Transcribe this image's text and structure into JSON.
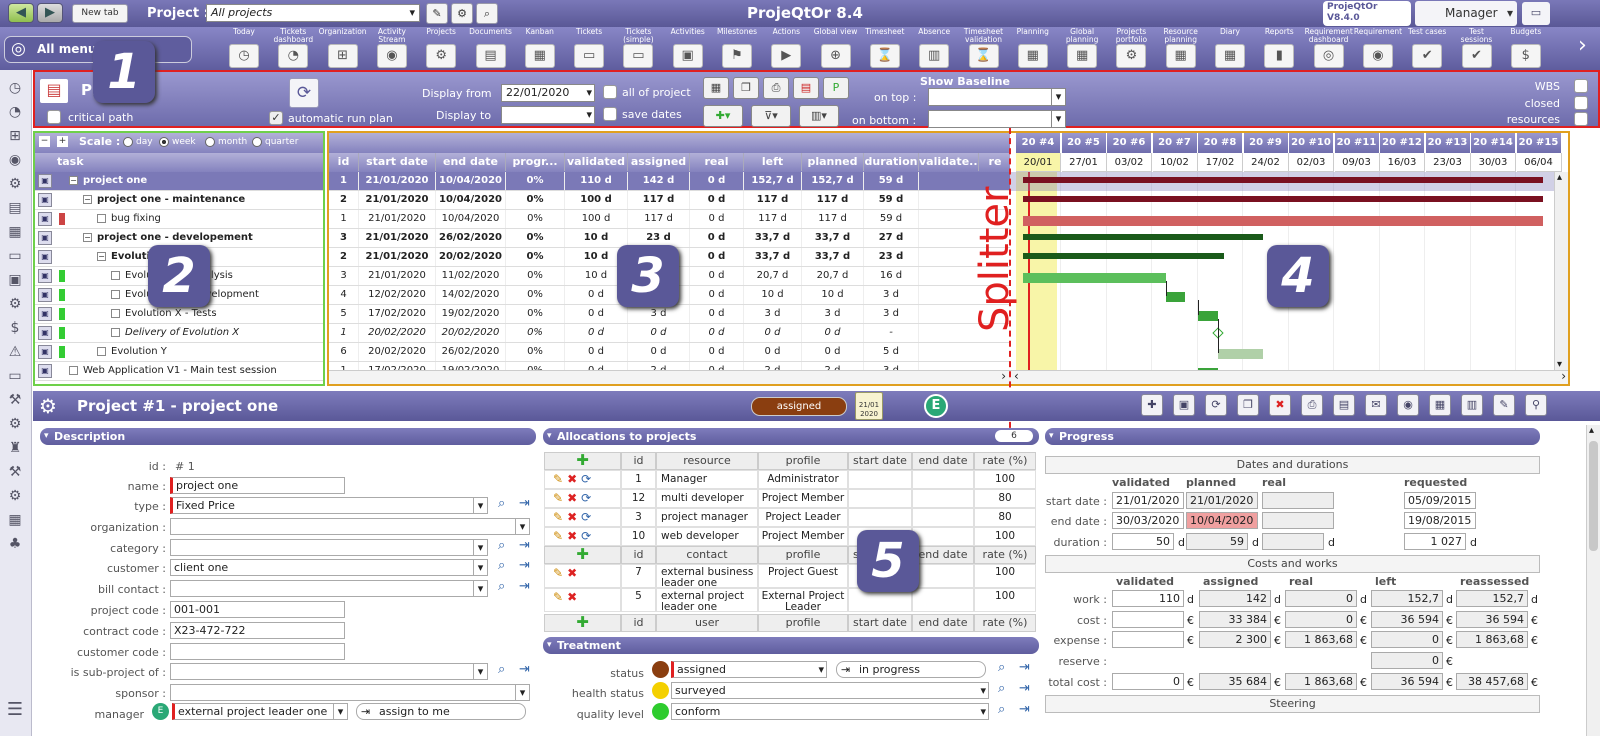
{
  "app": {
    "title": "ProjeQtOr 8.4",
    "logo_line1": "ProjeQtOr",
    "logo_line2": "V8.4.0",
    "user": "Manager",
    "project_label": "Project :",
    "project_value": "All projects",
    "new_tab": "New tab",
    "all_menus": "All menus"
  },
  "menu": [
    "Today",
    "Tickets dashboard",
    "Organizations",
    "Activity Stream",
    "Projects",
    "Documents",
    "Kanban",
    "Tickets",
    "Tickets (simple)",
    "Activities",
    "Milestones",
    "Actions",
    "Global view",
    "Timesheet",
    "Absence",
    "Timesheet validation",
    "Planning",
    "Global planning",
    "Projects portfolio",
    "Resource planning",
    "Diary",
    "Reports",
    "Requirements dashboard",
    "Requirements",
    "Test cases",
    "Test sessions",
    "Budgets"
  ],
  "toolbar": {
    "title": "Pl",
    "critical_path": "critical path",
    "automatic_run_plan": "automatic run plan",
    "display_from": "Display from",
    "display_from_value": "22/01/2020",
    "display_to": "Display to",
    "all_of_project": "all of project",
    "save_dates": "save dates",
    "show_baseline": "Show Baseline",
    "on_top": "on top :",
    "on_bottom": "on bottom :",
    "wbs": "WBS",
    "closed": "closed",
    "resources": "resources"
  },
  "grid": {
    "scale_label": "Scale :",
    "scale_options": [
      "day",
      "week",
      "month",
      "quarter"
    ],
    "task_header": "task",
    "columns": [
      "id",
      "start date",
      "end date",
      "progr...",
      "validated",
      "assigned",
      "real",
      "left",
      "planned",
      "duration",
      "validate...",
      "re"
    ],
    "rows": [
      {
        "name": "project one",
        "cells": [
          "1",
          "21/01/2020",
          "10/04/2020",
          "0%",
          "110 d",
          "142 d",
          "0 d",
          "152,7 d",
          "152,7 d",
          "59 d"
        ],
        "style": "sel"
      },
      {
        "name": "project one - maintenance",
        "cells": [
          "2",
          "21/01/2020",
          "10/04/2020",
          "0%",
          "100 d",
          "117 d",
          "0 d",
          "117 d",
          "117 d",
          "59 d"
        ],
        "style": "bold"
      },
      {
        "name": "bug fixing",
        "cells": [
          "1",
          "21/01/2020",
          "10/04/2020",
          "0%",
          "100 d",
          "117 d",
          "0 d",
          "117 d",
          "117 d",
          "59 d"
        ],
        "style": ""
      },
      {
        "name": "project one - developement",
        "cells": [
          "3",
          "21/01/2020",
          "26/02/2020",
          "0%",
          "10 d",
          "23 d",
          "0 d",
          "33,7 d",
          "33,7 d",
          "27 d"
        ],
        "style": "bold"
      },
      {
        "name": "Evolution X",
        "cells": [
          "2",
          "21/01/2020",
          "20/02/2020",
          "0%",
          "10 d",
          "23 d",
          "0 d",
          "33,7 d",
          "33,7 d",
          "23 d"
        ],
        "style": "bold"
      },
      {
        "name": "Evolution X - Analysis",
        "cells": [
          "3",
          "21/01/2020",
          "11/02/2020",
          "0%",
          "10 d",
          "7 d",
          "0 d",
          "20,7 d",
          "20,7 d",
          "16 d"
        ],
        "style": ""
      },
      {
        "name": "Evolution X - Development",
        "cells": [
          "4",
          "12/02/2020",
          "14/02/2020",
          "0%",
          "0 d",
          "10 d",
          "0 d",
          "10 d",
          "10 d",
          "3 d"
        ],
        "style": ""
      },
      {
        "name": "Evolution X - Tests",
        "cells": [
          "5",
          "17/02/2020",
          "19/02/2020",
          "0%",
          "0 d",
          "3 d",
          "0 d",
          "3 d",
          "3 d",
          "3 d"
        ],
        "style": ""
      },
      {
        "name": "Delivery of Evolution X",
        "cells": [
          "1",
          "20/02/2020",
          "20/02/2020",
          "0%",
          "0 d",
          "0 d",
          "0 d",
          "0 d",
          "0 d",
          "-"
        ],
        "style": "ital"
      },
      {
        "name": "Evolution Y",
        "cells": [
          "6",
          "20/02/2020",
          "26/02/2020",
          "0%",
          "0 d",
          "0 d",
          "0 d",
          "0 d",
          "0 d",
          "5 d"
        ],
        "style": ""
      },
      {
        "name": "Web Application V1 - Main test session",
        "cells": [
          "1",
          "17/02/2020",
          "19/02/2020",
          "0%",
          "0 d",
          "2 d",
          "0 d",
          "2 d",
          "2 d",
          "3 d"
        ],
        "style": ""
      }
    ]
  },
  "gantt": {
    "weeks": [
      "20 #4",
      "20 #5",
      "20 #6",
      "20 #7",
      "20 #8",
      "20 #9",
      "20 #10",
      "20 #11",
      "20 #12",
      "20 #13",
      "20 #14",
      "20 #15"
    ],
    "dates": [
      "20/01",
      "27/01",
      "03/02",
      "10/02",
      "17/02",
      "24/02",
      "02/03",
      "09/03",
      "16/03",
      "23/03",
      "30/03",
      "06/04"
    ]
  },
  "annotations": {
    "n1": "1",
    "n2": "2",
    "n3": "3",
    "n4": "4",
    "n5": "5",
    "splitter": "Splitter"
  },
  "detail": {
    "title": "Project  #1 - project one",
    "status_badge": "assigned",
    "date_badge_line1": "21/01",
    "date_badge_line2": "2020",
    "avatar": "E",
    "description": {
      "header": "Description",
      "id_label": "id :",
      "id_value": "#  1",
      "name_label": "name :",
      "name_value": "project one",
      "type_label": "type :",
      "type_value": "Fixed Price",
      "organization_label": "organization :",
      "category_label": "category :",
      "customer_label": "customer :",
      "customer_value": "client one",
      "bill_contact_label": "bill contact :",
      "project_code_label": "project code :",
      "project_code_value": "001-001",
      "contract_code_label": "contract code :",
      "contract_code_value": "X23-472-722",
      "customer_code_label": "customer code :",
      "subproject_label": "is sub-project of :",
      "sponsor_label": "sponsor :",
      "manager_label": "manager",
      "manager_value": "external project leader one",
      "assign_to_me": "assign to me"
    },
    "allocations": {
      "header": "Allocations to projects",
      "count": "6",
      "res_cols": [
        "id",
        "resource",
        "profile",
        "start date",
        "end date",
        "rate (%)"
      ],
      "res_rows": [
        [
          "1",
          "Manager",
          "Administrator",
          "",
          "",
          "100"
        ],
        [
          "12",
          "multi developer",
          "Project Member",
          "",
          "",
          "80"
        ],
        [
          "3",
          "project manager",
          "Project Leader",
          "",
          "",
          "80"
        ],
        [
          "10",
          "web developer",
          "Project Member",
          "",
          "",
          "100"
        ]
      ],
      "contact_cols": [
        "id",
        "contact",
        "profile",
        "start date",
        "end date",
        "rate (%)"
      ],
      "contact_rows": [
        [
          "7",
          "external business leader one",
          "Project Guest",
          "",
          "",
          "100"
        ],
        [
          "5",
          "external project leader one",
          "External Project Leader",
          "",
          "",
          "100"
        ]
      ],
      "user_cols": [
        "id",
        "user",
        "profile",
        "start date",
        "end date",
        "rate (%)"
      ]
    },
    "treatment": {
      "header": "Treatment",
      "status_label": "status",
      "status_value": "assigned",
      "status_next": "in progress",
      "health_label": "health status",
      "health_value": "surveyed",
      "quality_label": "quality level",
      "quality_value": "conform"
    },
    "progress": {
      "header": "Progress",
      "dates_title": "Dates and durations",
      "cols": [
        "validated",
        "planned",
        "real",
        "requested"
      ],
      "start_label": "start date :",
      "start_validated": "21/01/2020",
      "start_planned": "21/01/2020",
      "start_requested": "05/09/2015",
      "end_label": "end date :",
      "end_validated": "30/03/2020",
      "end_planned": "10/04/2020",
      "end_requested": "19/08/2015",
      "duration_label": "duration :",
      "duration_validated": "50",
      "duration_planned": "59",
      "duration_requested": "1 027",
      "unit_d": "d",
      "costs_title": "Costs and works",
      "cost_cols": [
        "validated",
        "assigned",
        "real",
        "left",
        "reassessed"
      ],
      "work_label": "work :",
      "work": [
        "110",
        "142",
        "0",
        "152,7",
        "152,7"
      ],
      "cost_label": "cost :",
      "cost": [
        "",
        "33 384",
        "0",
        "36 594",
        "36 594"
      ],
      "expense_label": "expense :",
      "expense": [
        "",
        "2 300",
        "1 863,68",
        "0",
        "1 863,68"
      ],
      "reserve_label": "reserve :",
      "reserve": "0",
      "total_label": "total cost :",
      "total": [
        "0",
        "35 684",
        "1 863,68",
        "36 594",
        "38 457,68"
      ],
      "unit_eur": "€",
      "steering_title": "Steering"
    }
  }
}
